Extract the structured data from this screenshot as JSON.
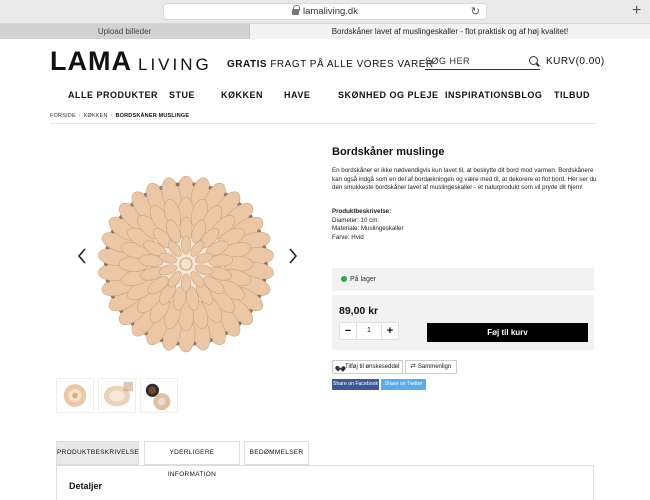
{
  "browser": {
    "url": "lamaliving.dk",
    "tabs": [
      {
        "label": "Upload billeder"
      },
      {
        "label": "Bordskåner lavet af muslingeskaller - flot praktisk og af høj kvalitet!"
      }
    ]
  },
  "header": {
    "logo_main": "LAMA",
    "logo_sub": "LIVING",
    "promo_bold": "GRATIS",
    "promo_rest": " FRAGT PÅ ALLE VORES VARER",
    "search_placeholder": "SØG HER",
    "cart_label": "KURV(0.00)"
  },
  "nav": {
    "items": [
      "ALLE PRODUKTER",
      "STUE",
      "KØKKEN",
      "HAVE",
      "SKØNHED OG PLEJE",
      "INSPIRATIONSBLOG",
      "TILBUD"
    ]
  },
  "breadcrumb": {
    "items": [
      "FORSIDE",
      "KØKKEN"
    ],
    "current": "BORDSKÅNER MUSLINGE"
  },
  "product": {
    "title": "Bordskåner muslinge",
    "description": "En bordskåner er ikke nødvendigvis kun lavet til, at beskytte dit bord mod varmen. Bordskånere kan også indgå som en del af bordækningen og være med til, at dekorere et flot bord. Her ser du den smukkeste bordskåner lavet af muslingeskaller - et naturprodukt som vil pryde dit hjem!",
    "spec_heading": "Produktbeskrivelse:",
    "specs": [
      "Diameter: 10 cm.",
      "Materiale: Muslingeskaller",
      "Farve: Hvid"
    ],
    "stock": "På lager",
    "price": "89,00 kr",
    "qty": "1",
    "add_to_cart": "Føj til kurv",
    "wishlist": "Tilføj til ønskeseddel",
    "compare": "Sammenlign",
    "share_fb": "Share on Facebook",
    "share_tw": "Share on Twitter"
  },
  "product_tabs": {
    "items": [
      "PRODUKTBESKRIVELSE",
      "YDERLIGERE INFORMATION",
      "BEDØMMELSER"
    ],
    "active": 0,
    "panel_heading": "Detaljer"
  },
  "colors": {
    "accent": "#000000",
    "stock_green": "#2fa84f",
    "facebook": "#3b5998",
    "twitter": "#55acee",
    "shell": "#ecc7a6"
  }
}
